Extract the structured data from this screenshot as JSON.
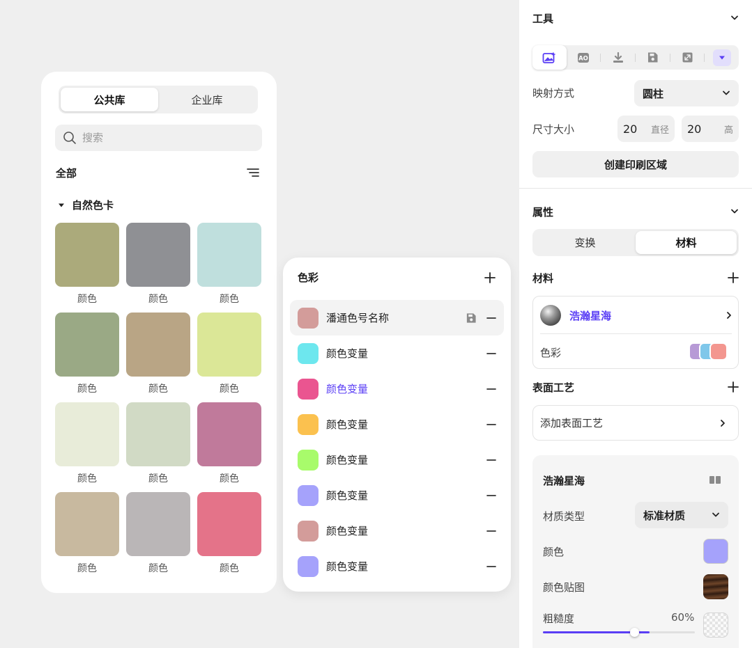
{
  "library": {
    "tabs": [
      {
        "label": "公共库",
        "active": true
      },
      {
        "label": "企业库",
        "active": false
      }
    ],
    "search_placeholder": "搜索",
    "filter_label": "全部",
    "group_label": "自然色卡",
    "swatches": [
      {
        "label": "颜色",
        "color": "#abaa7b"
      },
      {
        "label": "颜色",
        "color": "#8f9094"
      },
      {
        "label": "颜色",
        "color": "#bfdfdd"
      },
      {
        "label": "颜色",
        "color": "#9aa985"
      },
      {
        "label": "颜色",
        "color": "#b9a585"
      },
      {
        "label": "颜色",
        "color": "#dbe797"
      },
      {
        "label": "颜色",
        "color": "#e8ecd9"
      },
      {
        "label": "颜色",
        "color": "#d1dac5"
      },
      {
        "label": "颜色",
        "color": "#c07a9b"
      },
      {
        "label": "颜色",
        "color": "#c8b99f"
      },
      {
        "label": "颜色",
        "color": "#bab6b7"
      },
      {
        "label": "颜色",
        "color": "#e47389"
      }
    ]
  },
  "color_popup": {
    "title": "色彩",
    "items": [
      {
        "name": "潘通色号名称",
        "color": "#d39c9a",
        "selected": true,
        "active": false,
        "save": true
      },
      {
        "name": "颜色变量",
        "color": "#6de7ee",
        "selected": false,
        "active": false,
        "save": false
      },
      {
        "name": "颜色变量",
        "color": "#ea5590",
        "selected": false,
        "active": true,
        "save": false
      },
      {
        "name": "颜色变量",
        "color": "#fbc14f",
        "selected": false,
        "active": false,
        "save": false
      },
      {
        "name": "颜色变量",
        "color": "#a8fb6b",
        "selected": false,
        "active": false,
        "save": false
      },
      {
        "name": "颜色变量",
        "color": "#a5a2fb",
        "selected": false,
        "active": false,
        "save": false
      },
      {
        "name": "颜色变量",
        "color": "#d39c9a",
        "selected": false,
        "active": false,
        "save": false
      },
      {
        "name": "颜色变量",
        "color": "#a5a2fb",
        "selected": false,
        "active": false,
        "save": false
      }
    ]
  },
  "panel": {
    "tools_title": "工具",
    "mapping_label": "映射方式",
    "mapping_value": "圆柱",
    "size_label": "尺寸大小",
    "diameter_value": "20",
    "diameter_unit": "直径",
    "height_value": "20",
    "height_unit": "高",
    "create_button": "创建印刷区域",
    "props_title": "属性",
    "prop_tabs": [
      {
        "label": "变换",
        "active": false
      },
      {
        "label": "材料",
        "active": true
      }
    ],
    "material_title": "材料",
    "material_name": "浩瀚星海",
    "color_label": "色彩",
    "color_chips": [
      "#b79ad6",
      "#7fc7ea",
      "#f3968f"
    ],
    "surface_title": "表面工艺",
    "surface_add": "添加表面工艺",
    "detail": {
      "title": "浩瀚星海",
      "type_label": "材质类型",
      "type_value": "标准材质",
      "color_label": "颜色",
      "color_value": "#a5a2fb",
      "texture_label": "颜色贴图",
      "roughness_label": "粗糙度",
      "roughness_value": "60%",
      "roughness_fraction": 0.6
    },
    "accent": "#5a3ef5"
  }
}
